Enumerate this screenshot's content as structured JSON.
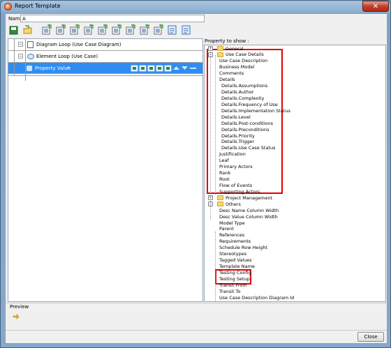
{
  "window": {
    "title": "Report Template",
    "close_glyph": "✕"
  },
  "name_field": {
    "label": "Name:",
    "value": "A"
  },
  "toolbar": {
    "icons": [
      "save-icon",
      "open-icon",
      "add-icon",
      "add-child-icon",
      "add-loop-icon",
      "add-table-icon",
      "add-image-icon",
      "add-text-icon",
      "add-property-icon",
      "add-page-break-icon",
      "add-detail-icon",
      "preview-icon",
      "report-icon"
    ]
  },
  "template_tree": {
    "rows": [
      {
        "label": "Diagram Loop (Use Case Diagram)",
        "expand": "−"
      },
      {
        "label": "Element Loop (Use Case)",
        "expand": "−"
      },
      {
        "label": "Property Value",
        "suffix": "*"
      }
    ]
  },
  "properties": {
    "label": "Property to show :",
    "expand_plus": "+",
    "expand_minus": "−",
    "items": [
      {
        "label": "General",
        "kind": "folder",
        "collapsed": true
      },
      {
        "label": "Use Case Details",
        "kind": "folder",
        "collapsed": false
      },
      {
        "label": "Use Case Description",
        "kind": "leaf",
        "depth": 2
      },
      {
        "label": "Business Model",
        "kind": "leaf",
        "depth": 2
      },
      {
        "label": "Comments",
        "kind": "leaf",
        "depth": 2
      },
      {
        "label": "Details",
        "kind": "leaf",
        "depth": 2
      },
      {
        "label": "Details.Assumptions",
        "kind": "leaf",
        "depth": 3
      },
      {
        "label": "Details.Author",
        "kind": "leaf",
        "depth": 3
      },
      {
        "label": "Details.Complexity",
        "kind": "leaf",
        "depth": 3
      },
      {
        "label": "Details.Frequency of Use",
        "kind": "leaf",
        "depth": 3
      },
      {
        "label": "Details.Implementation Status",
        "kind": "leaf",
        "depth": 3
      },
      {
        "label": "Details.Level",
        "kind": "leaf",
        "depth": 3
      },
      {
        "label": "Details.Post-conditions",
        "kind": "leaf",
        "depth": 3
      },
      {
        "label": "Details.Preconditions",
        "kind": "leaf",
        "depth": 3
      },
      {
        "label": "Details.Priority",
        "kind": "leaf",
        "depth": 3
      },
      {
        "label": "Details.Trigger",
        "kind": "leaf",
        "depth": 3
      },
      {
        "label": "Details.Use Case Status",
        "kind": "leaf",
        "depth": 3
      },
      {
        "label": "Justification",
        "kind": "leaf",
        "depth": 2
      },
      {
        "label": "Leaf",
        "kind": "leaf",
        "depth": 2
      },
      {
        "label": "Primary Actors",
        "kind": "leaf",
        "depth": 2
      },
      {
        "label": "Rank",
        "kind": "leaf",
        "depth": 2
      },
      {
        "label": "Root",
        "kind": "leaf",
        "depth": 2
      },
      {
        "label": "Flow of Events",
        "kind": "leaf",
        "depth": 2
      },
      {
        "label": "Supporting Actors",
        "kind": "leaf",
        "depth": 2
      },
      {
        "label": "Project Management",
        "kind": "folder",
        "collapsed": true
      },
      {
        "label": "Others",
        "kind": "folder",
        "collapsed": false
      },
      {
        "label": "Desc Name Column Width",
        "kind": "leaf",
        "depth": 2
      },
      {
        "label": "Desc Value Column Width",
        "kind": "leaf",
        "depth": 2
      },
      {
        "label": "Model Type",
        "kind": "leaf",
        "depth": 2
      },
      {
        "label": "Parent",
        "kind": "leaf",
        "depth": 2
      },
      {
        "label": "References",
        "kind": "leaf",
        "depth": 2
      },
      {
        "label": "Requirements",
        "kind": "leaf",
        "depth": 2
      },
      {
        "label": "Schedule Row Height",
        "kind": "leaf",
        "depth": 2
      },
      {
        "label": "Stereotypes",
        "kind": "leaf",
        "depth": 2
      },
      {
        "label": "Tagged Values",
        "kind": "leaf",
        "depth": 2
      },
      {
        "label": "Template Name",
        "kind": "leaf",
        "depth": 2
      },
      {
        "label": "Testing Config",
        "kind": "leaf",
        "depth": 2
      },
      {
        "label": "Testing Setup",
        "kind": "leaf",
        "depth": 2
      },
      {
        "label": "Transit From",
        "kind": "leaf",
        "depth": 2
      },
      {
        "label": "Transit To",
        "kind": "leaf",
        "depth": 2
      },
      {
        "label": "Use Case Description Diagram Id",
        "kind": "leaf",
        "depth": 2
      }
    ]
  },
  "preview": {
    "label": "Preview"
  },
  "footer": {
    "close_label": "Close"
  },
  "colors": {
    "selection": "#2f8df1",
    "highlight": "#e00000"
  }
}
